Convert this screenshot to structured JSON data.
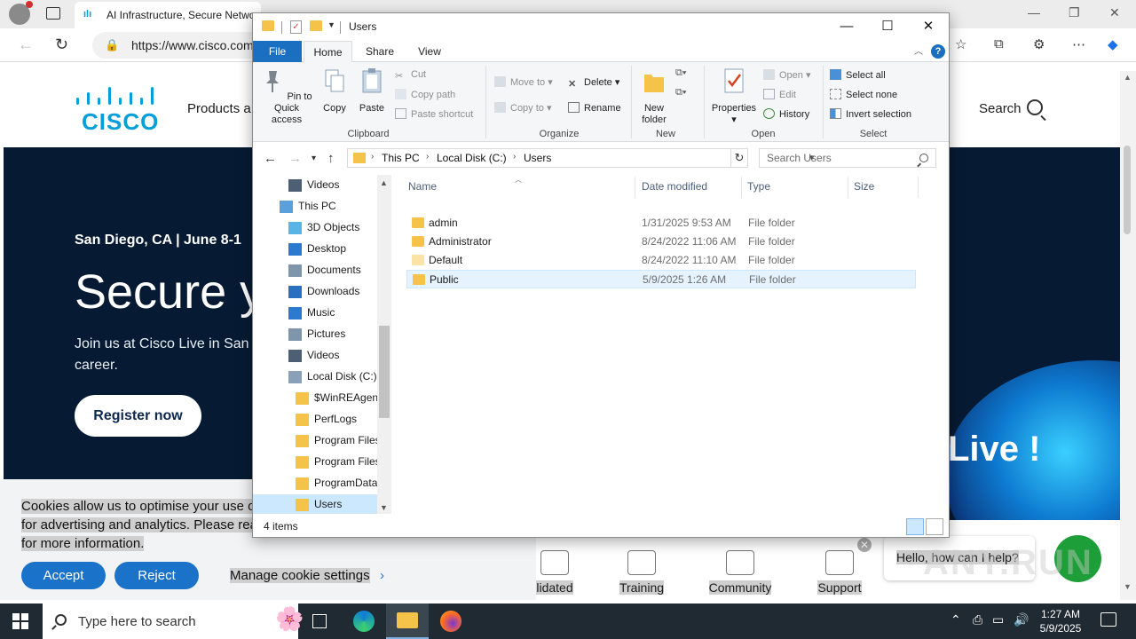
{
  "browser": {
    "tab_title": "AI Infrastructure, Secure Networ",
    "url": "https://www.cisco.com",
    "controls": {
      "minimize": "—",
      "restore": "❐",
      "close": "✕"
    }
  },
  "site": {
    "logo_text": "CISCO",
    "nav_products": "Products a",
    "search_label": "Search",
    "hero": {
      "event": "San Diego, CA | June 8-1",
      "title": "Secure y",
      "subtitle": "Join us at Cisco Live in San career.",
      "register": "Register now",
      "live": "Live !"
    },
    "cookie": {
      "text_line1": "Cookies allow us to optimise your use of",
      "text_line2": "for advertising and analytics. Please rea",
      "text_line3": "for more information.",
      "accept": "Accept",
      "reject": "Reject",
      "manage": "Manage cookie settings",
      "chevron": "›"
    },
    "quick_links": [
      {
        "label": "lidated"
      },
      {
        "label": "Training"
      },
      {
        "label": "Community"
      },
      {
        "label": "Support"
      }
    ],
    "chat": {
      "text": "Hello, how can I help?",
      "close": "✕"
    },
    "watermark": "ANY.RUN"
  },
  "explorer": {
    "title": "Users",
    "window_buttons": {
      "minimize": "—",
      "maximize": "☐",
      "close": "✕"
    },
    "tabs": [
      "File",
      "Home",
      "Share",
      "View"
    ],
    "help": "?",
    "ribbon": {
      "clipboard": {
        "label": "Clipboard",
        "pin": "Pin to Quick access",
        "copy": "Copy",
        "paste": "Paste",
        "cut": "Cut",
        "copy_path": "Copy path",
        "paste_shortcut": "Paste shortcut"
      },
      "organize": {
        "label": "Organize",
        "move_to": "Move to",
        "copy_to": "Copy to",
        "delete": "Delete",
        "rename": "Rename"
      },
      "new": {
        "label": "New",
        "new_folder": "New folder"
      },
      "open": {
        "label": "Open",
        "properties": "Properties",
        "open": "Open",
        "edit": "Edit",
        "history": "History"
      },
      "select": {
        "label": "Select",
        "select_all": "Select all",
        "select_none": "Select none",
        "invert": "Invert selection"
      }
    },
    "breadcrumb": [
      "This PC",
      "Local Disk (C:)",
      "Users"
    ],
    "search_placeholder": "Search Users",
    "tree": [
      {
        "label": "Videos",
        "icon": "videos-icon",
        "indent": 2
      },
      {
        "label": "This PC",
        "icon": "computer-icon",
        "indent": 1
      },
      {
        "label": "3D Objects",
        "icon": "3d-objects-icon",
        "indent": 2
      },
      {
        "label": "Desktop",
        "icon": "desktop-icon",
        "indent": 2
      },
      {
        "label": "Documents",
        "icon": "documents-icon",
        "indent": 2
      },
      {
        "label": "Downloads",
        "icon": "downloads-icon",
        "indent": 2
      },
      {
        "label": "Music",
        "icon": "music-icon",
        "indent": 2
      },
      {
        "label": "Pictures",
        "icon": "pictures-icon",
        "indent": 2
      },
      {
        "label": "Videos",
        "icon": "videos-icon",
        "indent": 2
      },
      {
        "label": "Local Disk (C:)",
        "icon": "drive-icon",
        "indent": 2
      },
      {
        "label": "$WinREAgent",
        "icon": "folder-icon",
        "indent": 3
      },
      {
        "label": "PerfLogs",
        "icon": "folder-icon",
        "indent": 3
      },
      {
        "label": "Program Files",
        "icon": "folder-icon",
        "indent": 3
      },
      {
        "label": "Program Files",
        "icon": "folder-icon",
        "indent": 3
      },
      {
        "label": "ProgramData",
        "icon": "folder-icon",
        "indent": 3
      },
      {
        "label": "Users",
        "icon": "folder-icon",
        "indent": 3,
        "selected": true
      }
    ],
    "columns": {
      "name": "Name",
      "date": "Date modified",
      "type": "Type",
      "size": "Size"
    },
    "files": [
      {
        "name": "admin",
        "date": "1/31/2025 9:53 AM",
        "type": "File folder"
      },
      {
        "name": "Administrator",
        "date": "8/24/2022 11:06 AM",
        "type": "File folder"
      },
      {
        "name": "Default",
        "date": "8/24/2022 11:10 AM",
        "type": "File folder"
      },
      {
        "name": "Public",
        "date": "5/9/2025 1:26 AM",
        "type": "File folder"
      }
    ],
    "status": "4 items"
  },
  "taskbar": {
    "search_placeholder": "Type here to search",
    "time": "1:27 AM",
    "date": "5/9/2025"
  }
}
